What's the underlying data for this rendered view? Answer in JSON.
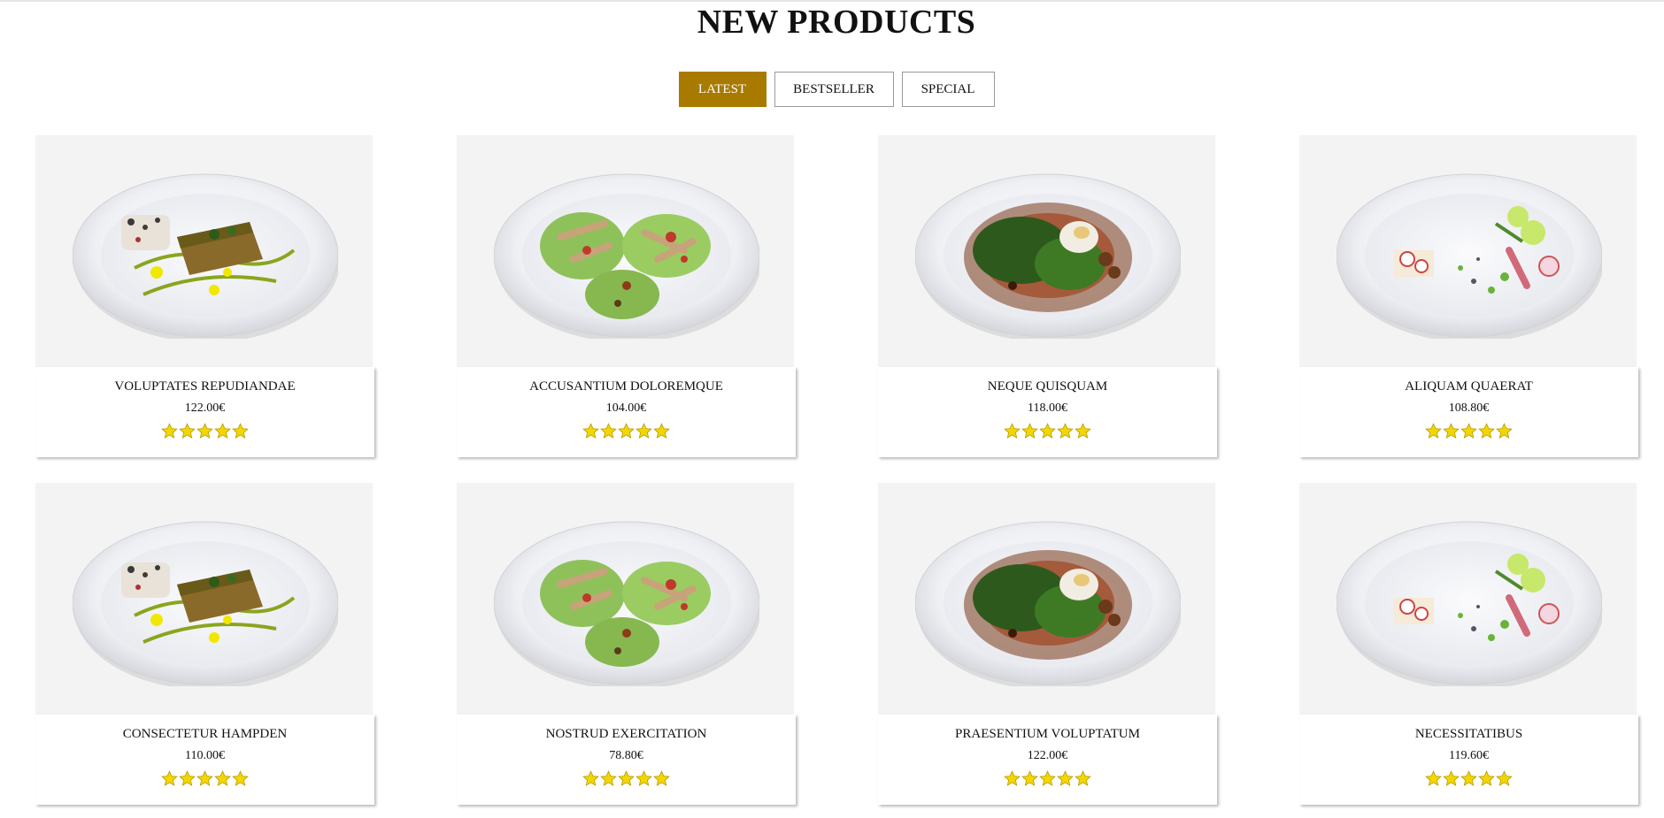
{
  "section": {
    "title": "NEW PRODUCTS"
  },
  "tabs": [
    {
      "label": "LATEST",
      "active": true
    },
    {
      "label": "BESTSELLER",
      "active": false
    },
    {
      "label": "SPECIAL",
      "active": false
    }
  ],
  "colors": {
    "accent": "#a87a00",
    "star": "#f2d600"
  },
  "products": [
    {
      "name": "VOLUPTATES REPUDIANDAE",
      "price": "122.00€",
      "rating": 5,
      "dish": "fish"
    },
    {
      "name": "ACCUSANTIUM DOLOREMQUE",
      "price": "104.00€",
      "rating": 5,
      "dish": "salad"
    },
    {
      "name": "NEQUE QUISQUAM",
      "price": "118.00€",
      "rating": 5,
      "dish": "greens"
    },
    {
      "name": "ALIQUAM QUAERAT",
      "price": "108.80€",
      "rating": 5,
      "dish": "radish"
    },
    {
      "name": "CONSECTETUR HAMPDEN",
      "price": "110.00€",
      "rating": 5,
      "dish": "fish"
    },
    {
      "name": "NOSTRUD EXERCITATION",
      "price": "78.80€",
      "rating": 5,
      "dish": "salad"
    },
    {
      "name": "PRAESENTIUM VOLUPTATUM",
      "price": "122.00€",
      "rating": 5,
      "dish": "greens"
    },
    {
      "name": "NECESSITATIBUS",
      "price": "119.60€",
      "rating": 5,
      "dish": "radish"
    }
  ]
}
